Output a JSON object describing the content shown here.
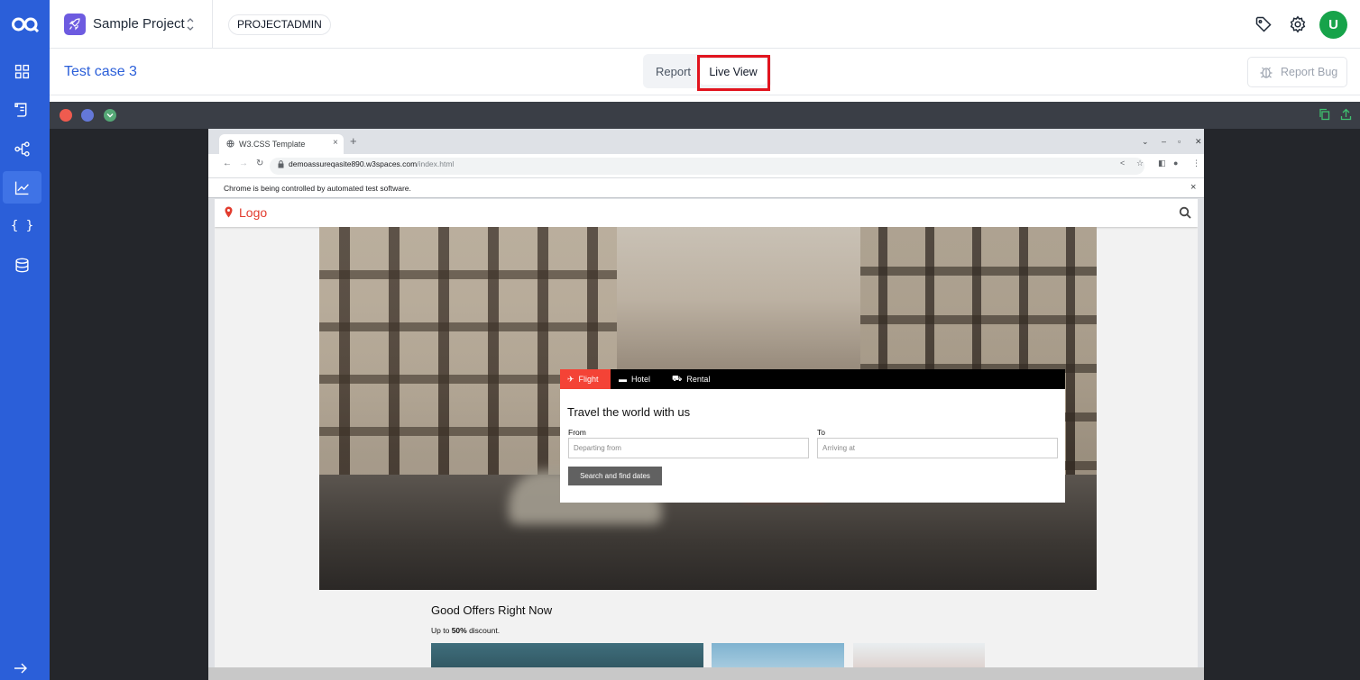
{
  "app": {
    "logo": "oq-logo"
  },
  "sidebar": {
    "items": [
      {
        "name": "dashboard",
        "icon": "grid-icon"
      },
      {
        "name": "test-cases",
        "icon": "scroll-icon"
      },
      {
        "name": "flows",
        "icon": "flow-icon"
      },
      {
        "name": "reports",
        "icon": "chart-line-icon",
        "active": true
      },
      {
        "name": "variables",
        "icon": "braces-icon",
        "label": "{ }"
      },
      {
        "name": "data",
        "icon": "database-icon"
      }
    ],
    "expand_icon": "arrow-right-icon"
  },
  "topbar": {
    "project_name": "Sample Project",
    "role": "PROJECTADMIN",
    "avatar_initial": "U"
  },
  "secbar": {
    "case_title": "Test case 3",
    "tabs": {
      "report": "Report",
      "live_view": "Live View"
    },
    "report_bug": "Report Bug"
  },
  "browser": {
    "tab_title": "W3.CSS Template",
    "tab_close": "×",
    "new_tab": "+",
    "url_host": "demoassureqasite890.w3spaces.com",
    "url_path": "/index.html",
    "infobar_text": "Chrome is being controlled by automated test software.",
    "infobar_close": "×"
  },
  "site": {
    "logo": "Logo",
    "booking": {
      "tabs": [
        "Flight",
        "Hotel",
        "Rental"
      ],
      "title": "Travel the world with us",
      "from_label": "From",
      "to_label": "To",
      "from_placeholder": "Departing from",
      "to_placeholder": "Arriving at",
      "search_button": "Search and find dates"
    },
    "offers_title": "Good Offers Right Now",
    "offers_sub_prefix": "Up to ",
    "offers_sub_bold": "50%",
    "offers_sub_suffix": " discount."
  },
  "colors": {
    "sidebar": "#2b5fd9",
    "accent": "#2b5fd9",
    "highlight": "#e1141e",
    "avatar": "#17a34a",
    "site_red": "#f44336"
  }
}
